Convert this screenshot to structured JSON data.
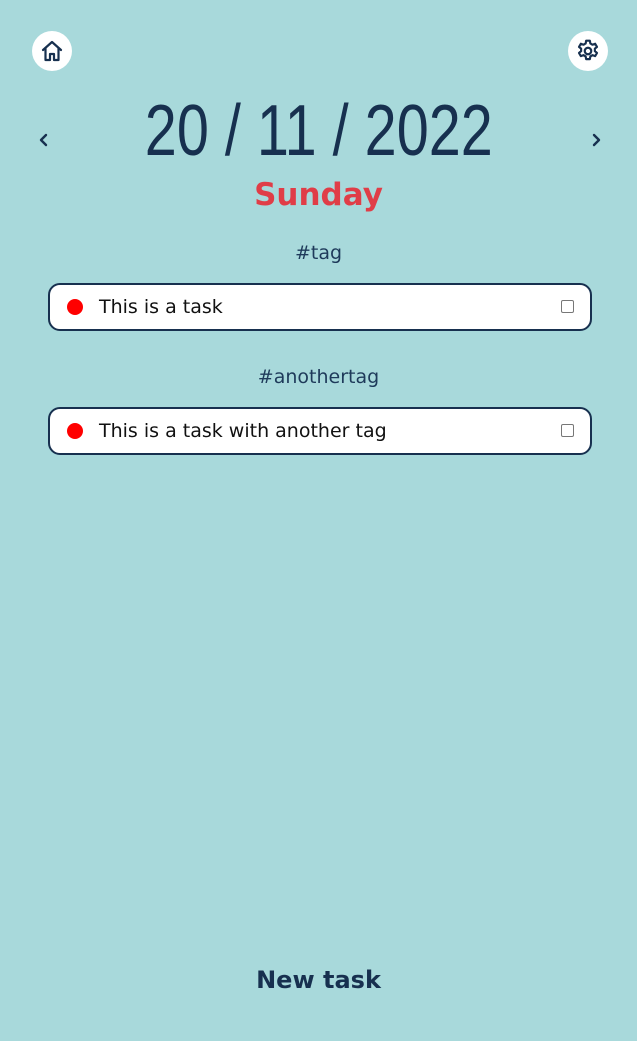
{
  "header": {
    "home_icon": "home-icon",
    "settings_icon": "gear-icon"
  },
  "date_nav": {
    "prev_icon": "chevron-left-icon",
    "next_icon": "chevron-right-icon",
    "date": "20 / 11 / 2022",
    "weekday": "Sunday"
  },
  "groups": [
    {
      "tag": "#tag",
      "tasks": [
        {
          "label": "This is a task",
          "priority_color": "#ff0000",
          "checked": false
        }
      ]
    },
    {
      "tag": "#anothertag",
      "tasks": [
        {
          "label": "This is a task with another tag",
          "priority_color": "#ff0000",
          "checked": false
        }
      ]
    }
  ],
  "footer": {
    "new_task_label": "New task"
  },
  "colors": {
    "background": "#a8d9db",
    "primary": "#17304f",
    "accent": "#e03d47",
    "priority_high": "#ff0000"
  }
}
